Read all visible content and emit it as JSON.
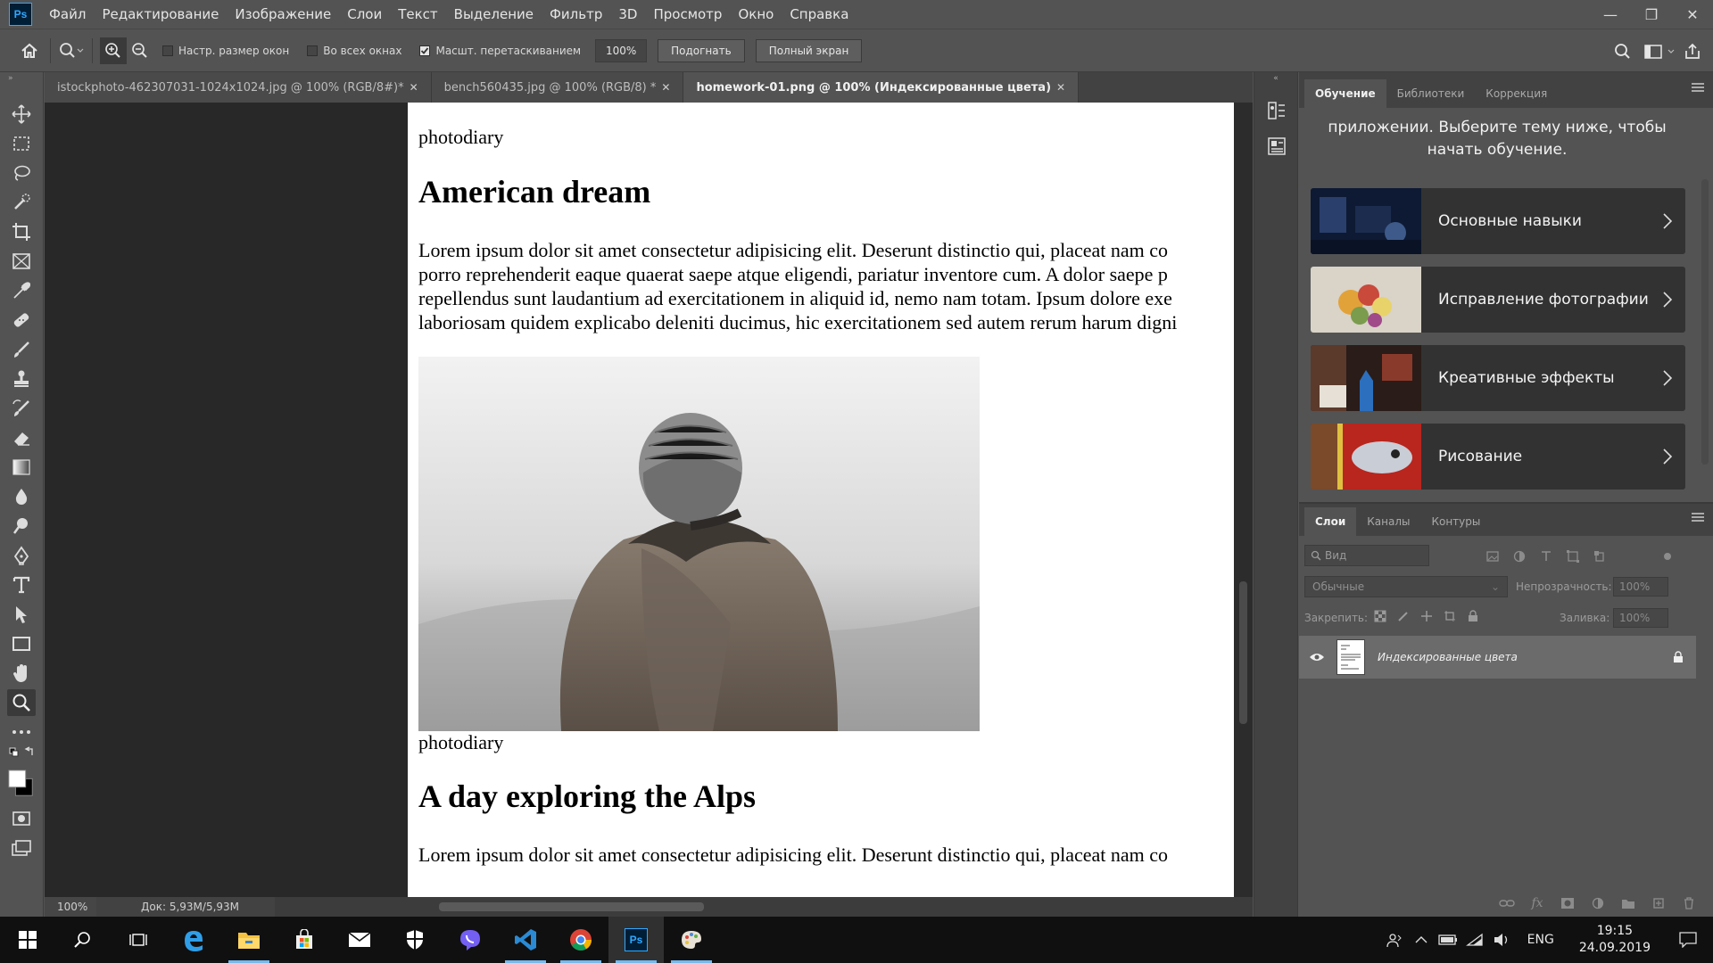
{
  "app": {
    "logo": "Ps",
    "menu": [
      "Файл",
      "Редактирование",
      "Изображение",
      "Слои",
      "Текст",
      "Выделение",
      "Фильтр",
      "3D",
      "Просмотр",
      "Окно",
      "Справка"
    ],
    "window_controls": {
      "minimize": "—",
      "restore": "❐",
      "close": "✕"
    }
  },
  "options_bar": {
    "resize_windows": {
      "label": "Настр. размер окон",
      "checked": false
    },
    "all_windows": {
      "label": "Во всех окнах",
      "checked": false
    },
    "scrubby_zoom": {
      "label": "Масшт. перетаскиванием",
      "checked": true
    },
    "zoom_value": "100%",
    "fit_button": "Подогнать",
    "fill_screen_button": "Полный экран"
  },
  "tabs": [
    {
      "title": "istockphoto-462307031-1024x1024.jpg @ 100% (RGB/8#)",
      "marker": "*",
      "close": "✕",
      "active": false
    },
    {
      "title": "bench560435.jpg @ 100% (RGB/8) *",
      "marker": "",
      "close": "✕",
      "active": false
    },
    {
      "title": "homework-01.png @ 100% (Индексированные цвета)",
      "marker": "*",
      "close": "✕",
      "active": true
    }
  ],
  "document": {
    "caption_1": "photodiary",
    "heading_1": "American dream",
    "para_1": [
      "Lorem ipsum dolor sit amet consectetur adipisicing elit. Deserunt distinctio qui, placeat nam co",
      "porro reprehenderit eaque quaerat saepe atque eligendi, pariatur inventore cum. A dolor saepe p",
      "repellendus sunt laudantium ad exercitationem in aliquid id, nemo nam totam. Ipsum dolore exe",
      "laboriosam quidem explicabo deleniti ducimus, hic exercitationem sed autem rerum harum digni"
    ],
    "caption_2": "photodiary",
    "heading_2": "A day exploring the Alps",
    "para_2": [
      "Lorem ipsum dolor sit amet consectetur adipisicing elit. Deserunt distinctio qui, placeat nam co"
    ]
  },
  "status": {
    "zoom": "100%",
    "doc_size": "Док: 5,93M/5,93M",
    "arrow": "❯"
  },
  "learn_panel": {
    "tabs": [
      "Обучение",
      "Библиотеки",
      "Коррекция"
    ],
    "intro_line_1": "приложении. Выберите тему ниже, чтобы",
    "intro_line_2": "начать обучение.",
    "cards": [
      {
        "label": "Основные навыки"
      },
      {
        "label": "Исправление фотографии"
      },
      {
        "label": "Креативные эффекты"
      },
      {
        "label": "Рисование"
      }
    ]
  },
  "layers_panel": {
    "tabs": [
      "Слои",
      "Каналы",
      "Контуры"
    ],
    "filter_placeholder": "Вид",
    "blend_mode": "Обычные",
    "opacity_label": "Непрозрачность:",
    "opacity_value": "100%",
    "lock_label": "Закрепить:",
    "fill_label": "Заливка:",
    "fill_value": "100%",
    "layer_name": "Индексированные цвета"
  },
  "taskbar": {
    "language": "ENG",
    "time": "19:15",
    "date": "24.09.2019"
  },
  "colors": {
    "ps_blue": "#31a8ff",
    "panel_bg": "#535353",
    "canvas_bg": "#282828"
  }
}
